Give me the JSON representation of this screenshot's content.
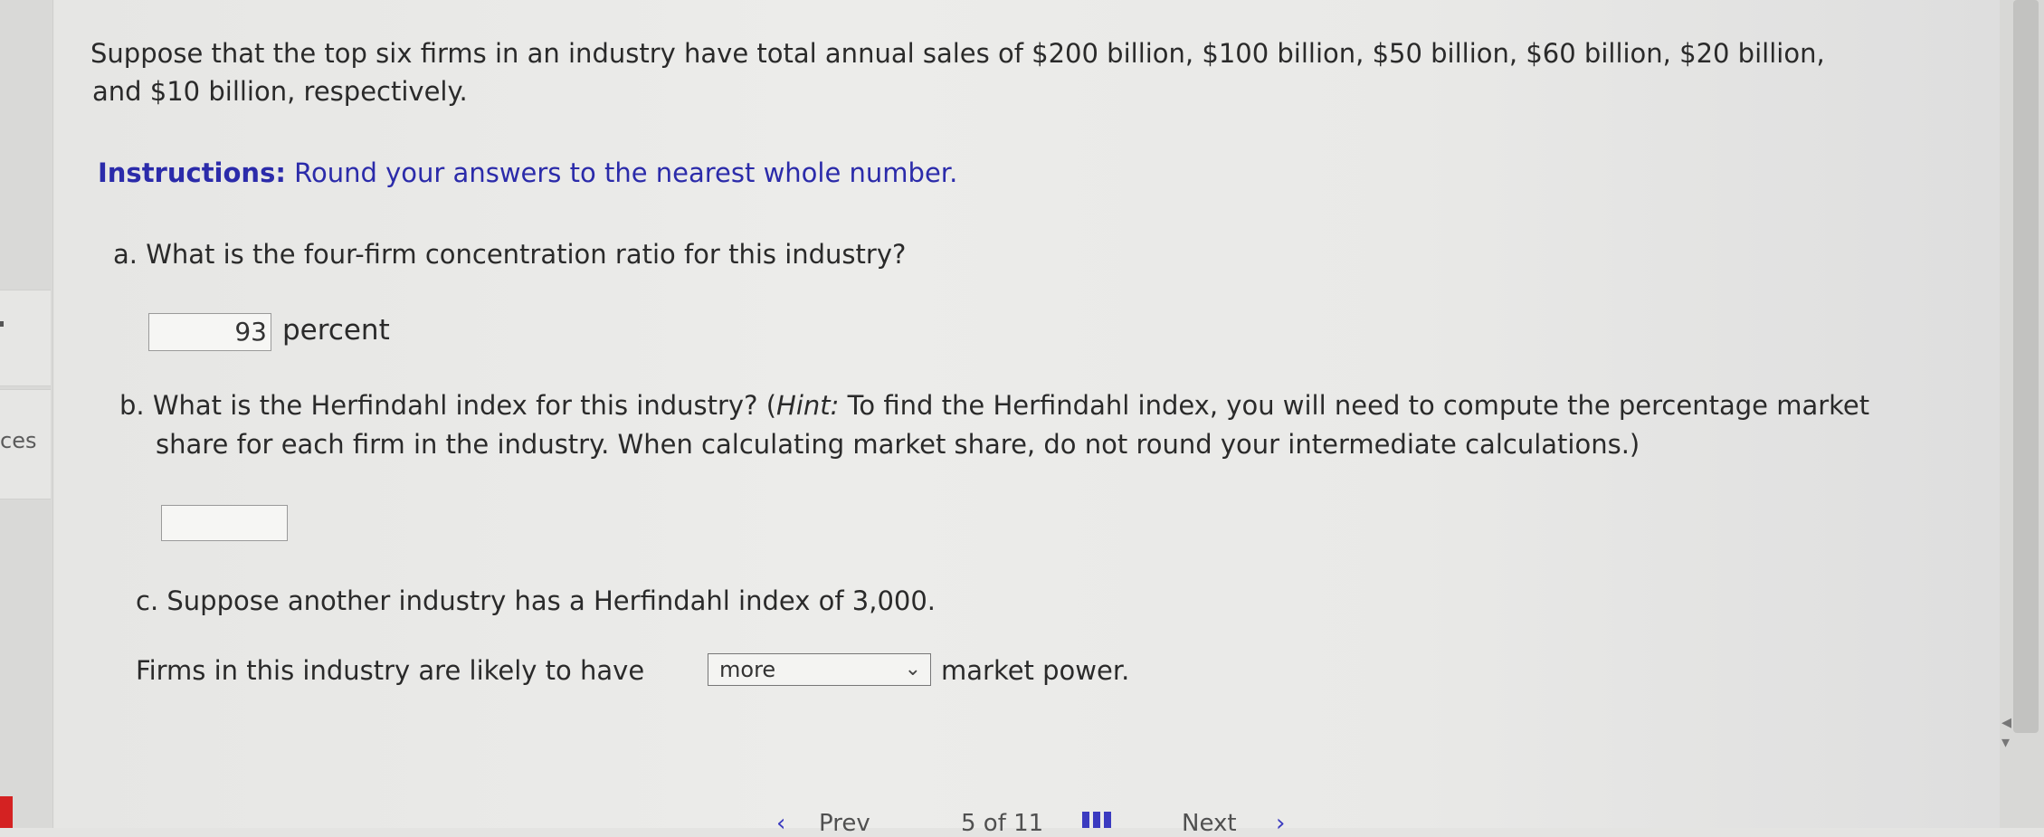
{
  "sidebar": {
    "partial_label": "ces"
  },
  "question": {
    "intro_line1": "Suppose that the top six firms in an industry have total annual sales of $200 billion, $100 billion, $50 billion, $60 billion, $20 billion,",
    "intro_line2": "and $10 billion, respectively.",
    "instructions_label": "Instructions:",
    "instructions_text": " Round your answers to the nearest whole number.",
    "part_a": {
      "text": "a. What is the four-firm concentration ratio for this industry?",
      "answer": "93",
      "unit": "percent"
    },
    "part_b": {
      "line1_prefix": "b. What is the Herfindahl index for this industry? (",
      "hint_label": "Hint:",
      "line1_suffix": " To find the Herfindahl index, you will need to compute the percentage market",
      "line2": "share for each firm in the industry. When calculating market share, do not round your intermediate calculations.)",
      "answer": ""
    },
    "part_c": {
      "text": "c. Suppose another industry has a Herfindahl index of 3,000.",
      "sentence_prefix": "Firms in this industry are likely to have",
      "selected_option": "more",
      "sentence_suffix": "market power."
    }
  },
  "bottom_nav": {
    "prev_arrow": "‹",
    "prev_label": "Prev",
    "page_info": "5 of 11",
    "next_label": "Next",
    "next_arrow": "›"
  },
  "colors": {
    "instructions": "#2b2baa",
    "nav_accent": "#3b3bc0",
    "red_marker": "#d42222"
  }
}
